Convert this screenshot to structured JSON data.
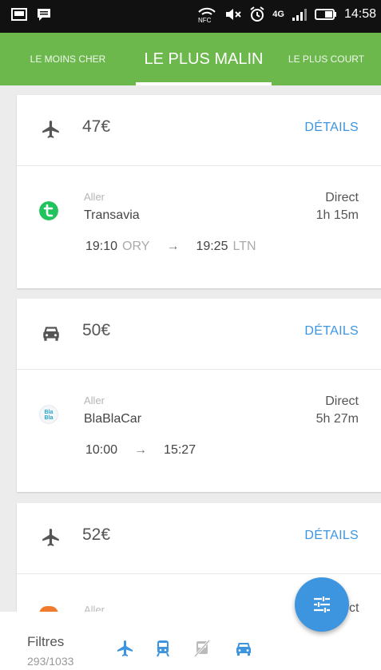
{
  "status_bar": {
    "time": "14:58",
    "network": "4G"
  },
  "tabs": [
    {
      "label": "LE MOINS CHER"
    },
    {
      "label": "LE PLUS MALIN",
      "active": true
    },
    {
      "label": "LE PLUS COURT"
    }
  ],
  "details_label": "DÉTAILS",
  "results": [
    {
      "mode_icon": "plane-icon",
      "price": "47€",
      "direction": "Aller",
      "operator": "Transavia",
      "operator_logo_color": "#21c35c",
      "depart_time": "19:10",
      "depart_code": "ORY",
      "arrive_time": "19:25",
      "arrive_code": "LTN",
      "stops": "Direct",
      "duration": "1h 15m"
    },
    {
      "mode_icon": "car-icon",
      "price": "50€",
      "direction": "Aller",
      "operator": "BlaBlaCar",
      "operator_logo_text": "Bla Bla",
      "depart_time": "10:00",
      "arrive_time": "15:27",
      "stops": "Direct",
      "duration": "5h 27m"
    },
    {
      "mode_icon": "plane-icon",
      "price": "52€",
      "direction": "Aller",
      "stops_partial": "ct"
    }
  ],
  "filter_bar": {
    "label": "Filtres",
    "count": "293/1033",
    "icons": [
      "plane-icon",
      "train-icon",
      "bus-disabled-icon",
      "car-icon"
    ]
  },
  "colors": {
    "accent_green": "#6cb84c",
    "accent_blue": "#3d95e0"
  }
}
